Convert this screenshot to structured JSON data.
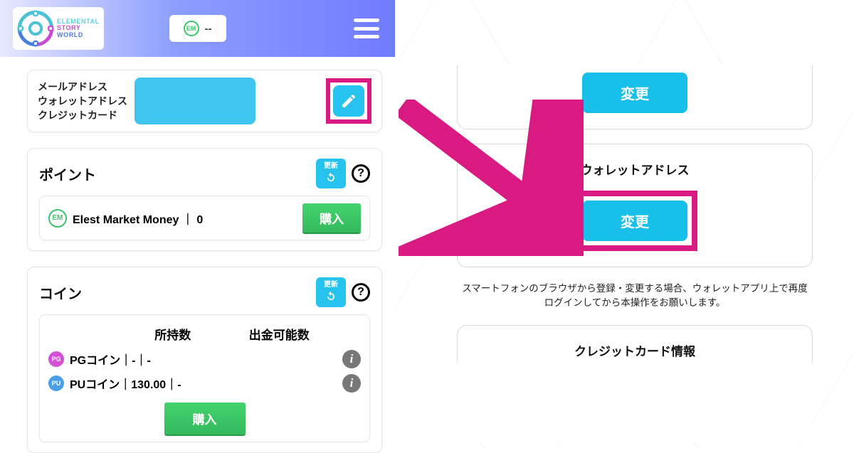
{
  "brand": {
    "l1": "ELEMENTAL",
    "l2": "STORY",
    "l3": "WORLD"
  },
  "header": {
    "badge_value": "--",
    "badge_icon_text": "EM"
  },
  "account": {
    "labels": {
      "email": "メールアドレス",
      "wallet": "ウォレットアドレス",
      "credit": "クレジットカード"
    }
  },
  "points": {
    "title": "ポイント",
    "refresh_label": "更新",
    "row": {
      "icon_text": "EM",
      "name": "Elest Market Money",
      "sep": "｜",
      "value": "0",
      "buy_label": "購入"
    }
  },
  "coins": {
    "title": "コイン",
    "refresh_label": "更新",
    "headers": {
      "held": "所持数",
      "withdrawable": "出金可能数"
    },
    "rows": [
      {
        "icon": "PG",
        "name": "PGコイン",
        "held": "-",
        "withdrawable": "-"
      },
      {
        "icon": "PU",
        "name": "PUコイン",
        "held": "130.00",
        "withdrawable": "-"
      }
    ],
    "buy_label": "購入"
  },
  "right": {
    "change_label": "変更",
    "wallet_title": "ウォレットアドレス",
    "note": "スマートフォンのブラウザから登録・変更する場合、ウォレットアプリ上で再度ログインしてから本操作をお願いします。",
    "credit_title": "クレジットカード情報"
  }
}
